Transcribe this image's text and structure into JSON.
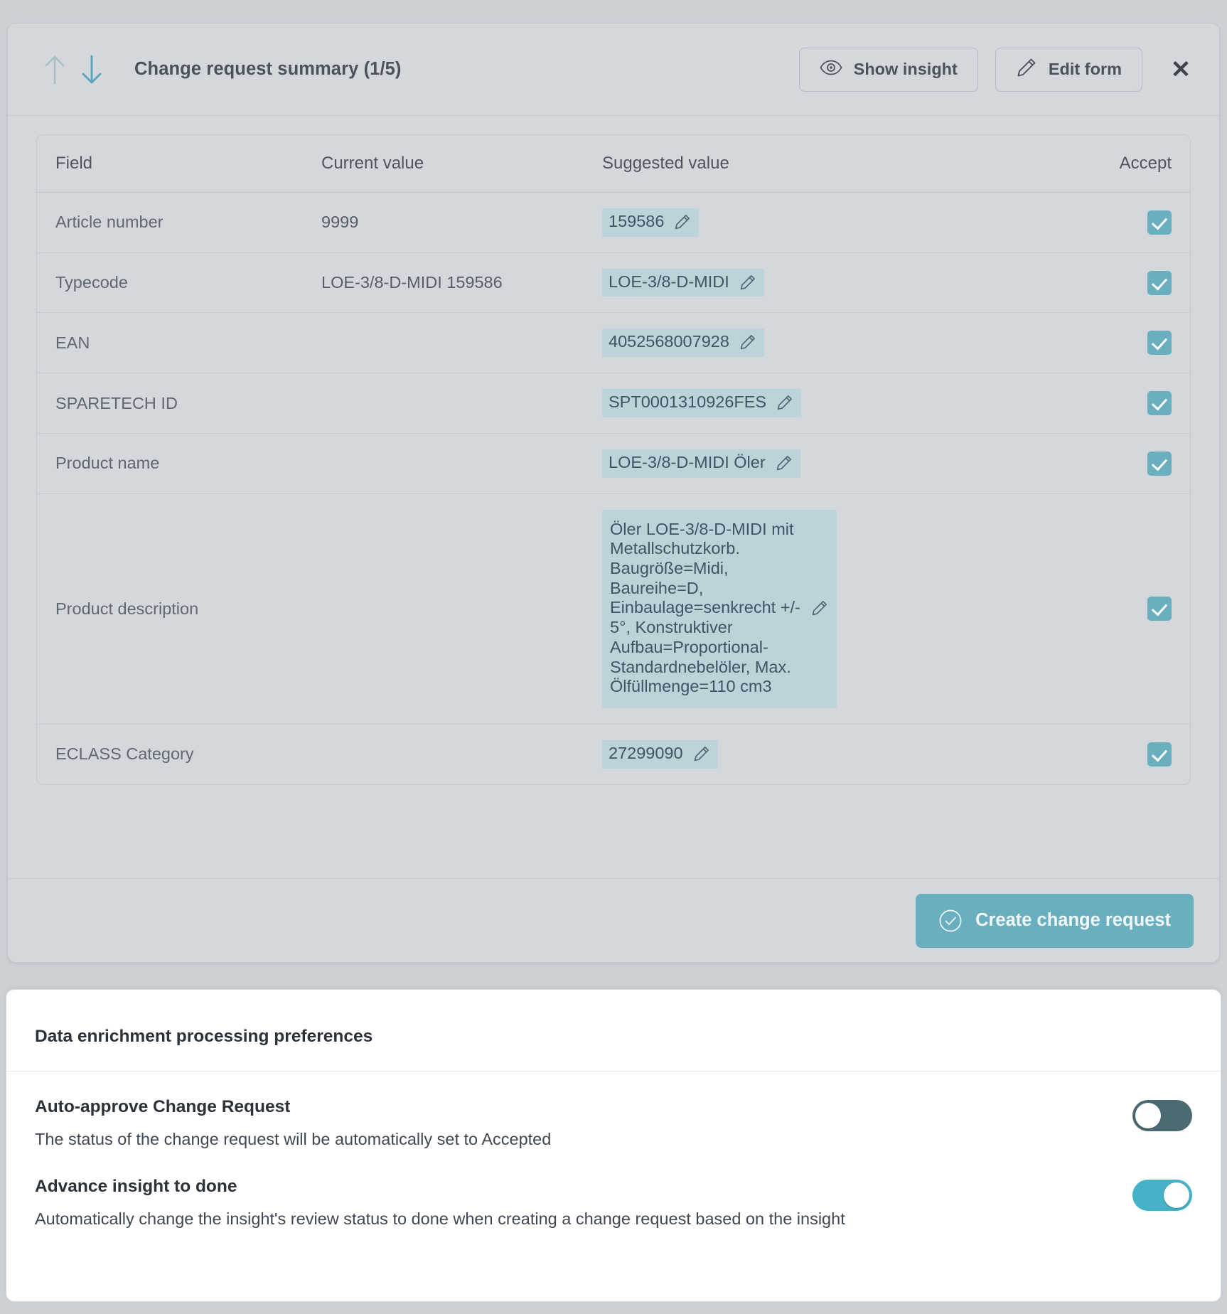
{
  "change_request": {
    "title": "Change request summary (1/5)",
    "nav": {
      "prev_icon": "arrow-up-icon",
      "next_icon": "arrow-down-icon"
    },
    "buttons": {
      "show_insight": "Show insight",
      "edit_form": "Edit form",
      "close": "✕",
      "create": "Create change request"
    },
    "table": {
      "headers": {
        "field": "Field",
        "current": "Current value",
        "suggested": "Suggested value",
        "accept": "Accept"
      },
      "rows": [
        {
          "field": "Article number",
          "current": "9999",
          "suggested": "159586",
          "accepted": true,
          "multiline": false
        },
        {
          "field": "Typecode",
          "current": "LOE-3/8-D-MIDI 159586",
          "suggested": "LOE-3/8-D-MIDI",
          "accepted": true,
          "multiline": false
        },
        {
          "field": "EAN",
          "current": "",
          "suggested": "4052568007928",
          "accepted": true,
          "multiline": false
        },
        {
          "field": "SPARETECH ID",
          "current": "",
          "suggested": "SPT0001310926FES",
          "accepted": true,
          "multiline": false
        },
        {
          "field": "Product name",
          "current": "",
          "suggested": "LOE-3/8-D-MIDI Öler",
          "accepted": true,
          "multiline": false
        },
        {
          "field": "Product description",
          "current": "",
          "suggested": "Öler LOE-3/8-D-MIDI mit Metallschutzkorb. Baugröße=Midi, Baureihe=D, Einbaulage=senkrecht +/- 5°, Konstruktiver Aufbau=Proportional-Standardnebelöler, Max. Ölfüllmenge=110 cm3",
          "accepted": true,
          "multiline": true
        },
        {
          "field": "ECLASS Category",
          "current": "",
          "suggested": "27299090",
          "accepted": true,
          "multiline": false
        }
      ]
    }
  },
  "preferences": {
    "title": "Data enrichment processing preferences",
    "items": [
      {
        "label": "Auto-approve Change Request",
        "description": "The status of the change request will be automatically set to Accepted",
        "enabled": false
      },
      {
        "label": "Advance insight to done",
        "description": "Automatically change the insight's review status to done when creating a change request based on the insight",
        "enabled": true
      }
    ]
  },
  "colors": {
    "accent": "#6aafc0",
    "toggle_on": "#46b2c8",
    "toggle_off": "#4c6a72",
    "chip_bg": "#bcd3da",
    "panel_bg": "#d4d7dc",
    "page_bg": "#cdd1d6"
  }
}
